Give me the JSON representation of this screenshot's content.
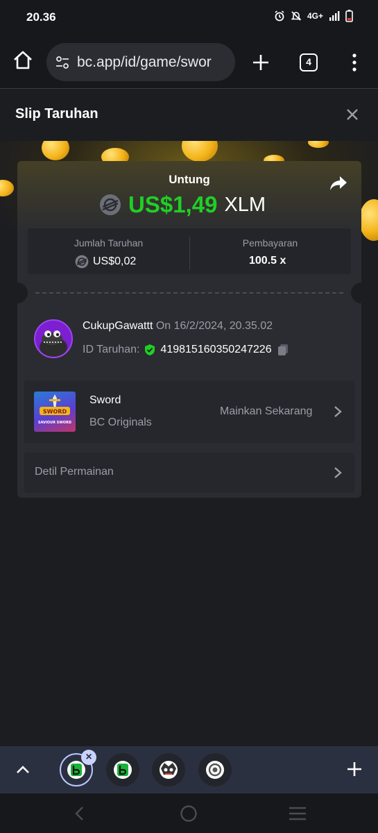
{
  "status_bar": {
    "time": "20.36",
    "network": "4G+"
  },
  "browser": {
    "url": "bc.app/id/game/swor",
    "tab_count": "4"
  },
  "modal": {
    "title": "Slip Taruhan"
  },
  "bet_slip": {
    "win_label": "Untung",
    "win_amount": "US$1,49",
    "currency": "XLM",
    "bet_amount_label": "Jumlah Taruhan",
    "bet_amount": "US$0,02",
    "payout_label": "Pembayaran",
    "payout": "100.5 x",
    "username": "CukupGawattt",
    "date": "On 16/2/2024, 20.35.02",
    "bet_id_label": "ID Taruhan:",
    "bet_id": "419815160350247226"
  },
  "game": {
    "name": "Sword",
    "provider": "BC Originals",
    "play_label": "Mainkan Sekarang",
    "thumb_text_top": "SWORD",
    "thumb_text_bottom": "SAVIOUR SWORD"
  },
  "details": {
    "label": "Detil Permainan"
  },
  "icons": {
    "crypto": "stellar-xlm-icon",
    "verified": "shield-check-icon",
    "copy": "copy-icon",
    "share": "share-arrow-icon"
  },
  "colors": {
    "win_green": "#1fcf26",
    "background": "#1c1d21",
    "card": "#2a2c31",
    "avatar_purple": "#7b1fd1"
  }
}
